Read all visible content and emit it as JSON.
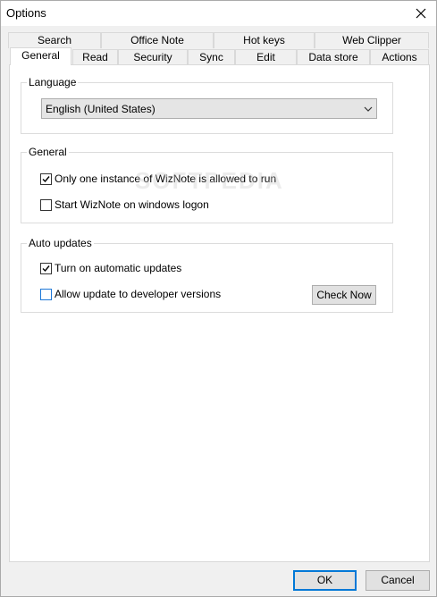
{
  "window": {
    "title": "Options"
  },
  "tabs_row1": [
    {
      "label": "Search"
    },
    {
      "label": "Office Note"
    },
    {
      "label": "Hot keys"
    },
    {
      "label": "Web Clipper"
    }
  ],
  "tabs_row2": [
    {
      "label": "General"
    },
    {
      "label": "Read"
    },
    {
      "label": "Security"
    },
    {
      "label": "Sync"
    },
    {
      "label": "Edit"
    },
    {
      "label": "Data store"
    },
    {
      "label": "Actions"
    }
  ],
  "language_group": {
    "legend": "Language",
    "selected": "English (United States)"
  },
  "general_group": {
    "legend": "General",
    "single_instance": {
      "label": "Only one instance of WizNote is allowed to run",
      "checked": true
    },
    "start_logon": {
      "label": "Start WizNote on windows logon",
      "checked": false
    }
  },
  "updates_group": {
    "legend": "Auto updates",
    "auto_updates": {
      "label": "Turn on automatic updates",
      "checked": true
    },
    "developer_versions": {
      "label": "Allow update to developer versions",
      "checked": false
    },
    "check_now": "Check Now"
  },
  "footer": {
    "ok": "OK",
    "cancel": "Cancel"
  },
  "watermark": "SOFTPEDIA",
  "colors": {
    "accent": "#0078d7",
    "panel": "#ffffff",
    "background": "#f0f0f0"
  }
}
